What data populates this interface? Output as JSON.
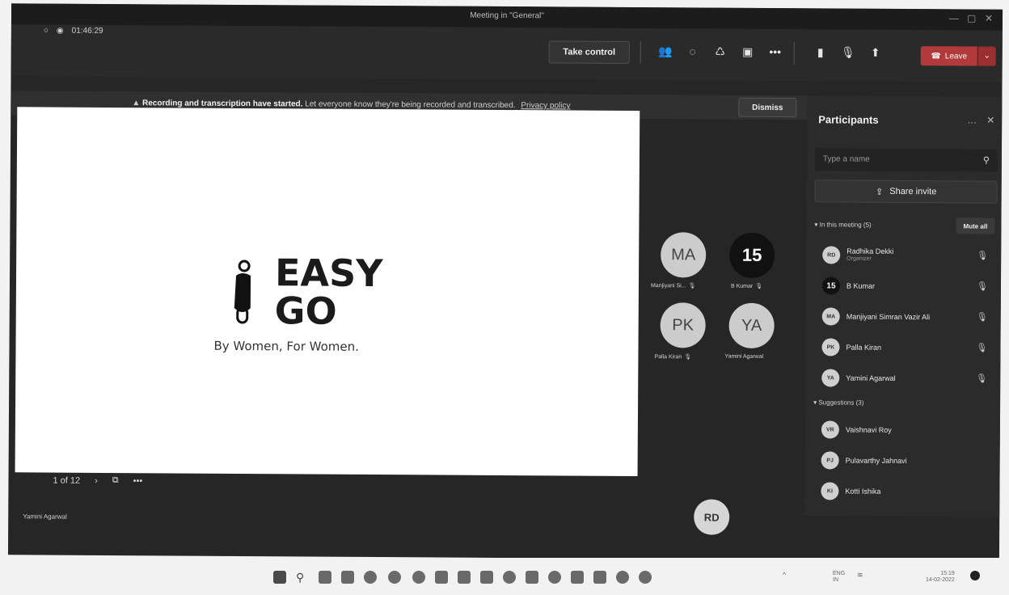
{
  "window": {
    "title": "Meeting in \"General\""
  },
  "toolbar": {
    "timer": "01:46:29",
    "take_control": "Take control",
    "leave": "Leave"
  },
  "banner": {
    "bold_text": "Recording and transcription have started.",
    "text": "Let everyone know they're being recorded and transcribed.",
    "link": "Privacy policy",
    "dismiss": "Dismiss"
  },
  "slide": {
    "word1": "EASY",
    "word2": "GO",
    "tagline": "By Women, For Women.",
    "page": "1 of 12"
  },
  "presenter": "Yamini Agarwal",
  "tiles": [
    {
      "initials": "MA",
      "name": "Manjiyani Si..."
    },
    {
      "initials": "15",
      "name": "B Kumar"
    },
    {
      "initials": "PK",
      "name": "Palla Kiran"
    },
    {
      "initials": "YA",
      "name": "Yamini Agarwal"
    }
  ],
  "self_tile": "RD",
  "panel": {
    "title": "Participants",
    "search_placeholder": "Type a name",
    "share": "Share invite",
    "in_meeting": "In this meeting (5)",
    "mute_all": "Mute all",
    "suggestions": "Suggestions (3)",
    "participants": [
      {
        "initials": "RD",
        "name": "Radhika Dekki",
        "role": "Organizer"
      },
      {
        "initials": "15",
        "name": "B Kumar"
      },
      {
        "initials": "MA",
        "name": "Manjiyani Simran Vazir Ali"
      },
      {
        "initials": "PK",
        "name": "Palla Kiran"
      },
      {
        "initials": "YA",
        "name": "Yamini Agarwal"
      }
    ],
    "suggested": [
      {
        "initials": "VR",
        "name": "Vaishnavi Roy"
      },
      {
        "initials": "PJ",
        "name": "Pulavarthy Jahnavi"
      },
      {
        "initials": "KI",
        "name": "Kotti Ishika"
      }
    ]
  },
  "tray": {
    "lang": "ENG",
    "region": "IN",
    "time": "15:19",
    "date": "14-02-2022"
  }
}
